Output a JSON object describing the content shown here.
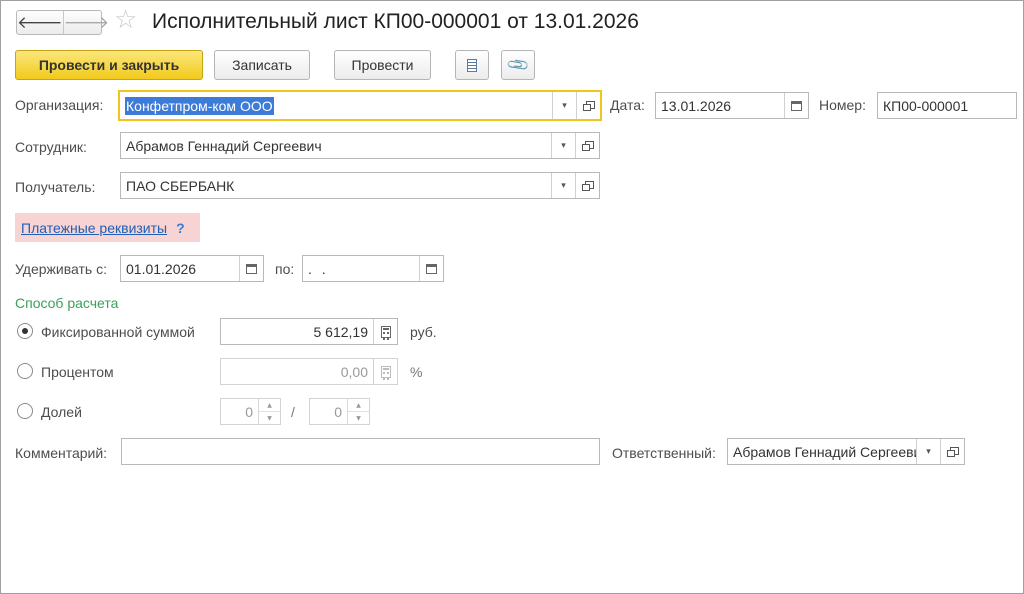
{
  "header": {
    "back_glyph": "🡐",
    "forward_glyph": "🡒",
    "star_glyph": "☆",
    "title": "Исполнительный лист КП00-000001 от 13.01.2026"
  },
  "toolbar": {
    "post_and_close": "Провести и закрыть",
    "save": "Записать",
    "post": "Провести",
    "clip_glyph": "📎"
  },
  "form": {
    "organization": {
      "label": "Организация:",
      "value": "Конфетпром-ком ООО"
    },
    "date": {
      "label": "Дата:",
      "value": "13.01.2026"
    },
    "number": {
      "label": "Номер:",
      "value": "КП00-000001"
    },
    "employee": {
      "label": "Сотрудник:",
      "value": "Абрамов Геннадий Сергеевич"
    },
    "recipient": {
      "label": "Получатель:",
      "value": "ПАО СБЕРБАНК"
    },
    "payment_link": "Платежные реквизиты",
    "help": "?",
    "withhold_from": {
      "label": "Удерживать с:",
      "value": "01.01.2026"
    },
    "withhold_to": {
      "label": "по:",
      "value": " .  ."
    },
    "calc_section": "Способ расчета",
    "fixed": {
      "label": "Фиксированной суммой",
      "value": "5 612,19",
      "unit": "руб.",
      "selected": true
    },
    "percent": {
      "label": "Процентом",
      "value": "0,00",
      "unit": "%"
    },
    "share": {
      "label": "Долей",
      "numerator": "0",
      "separator": "/",
      "denominator": "0"
    },
    "comment": {
      "label": "Комментарий:",
      "value": ""
    },
    "responsible": {
      "label": "Ответственный:",
      "value": "Абрамов Геннадий Сергеевич"
    }
  },
  "glyphs": {
    "dropdown": "▾",
    "spin_up": "▲",
    "spin_down": "▼"
  },
  "colors": {
    "primary_button": "#f2cb1c",
    "focus_border": "#f0c51c",
    "link": "#1f5fb8",
    "section_title": "#3aa05a",
    "link_highlight": "#f7d3d3"
  }
}
